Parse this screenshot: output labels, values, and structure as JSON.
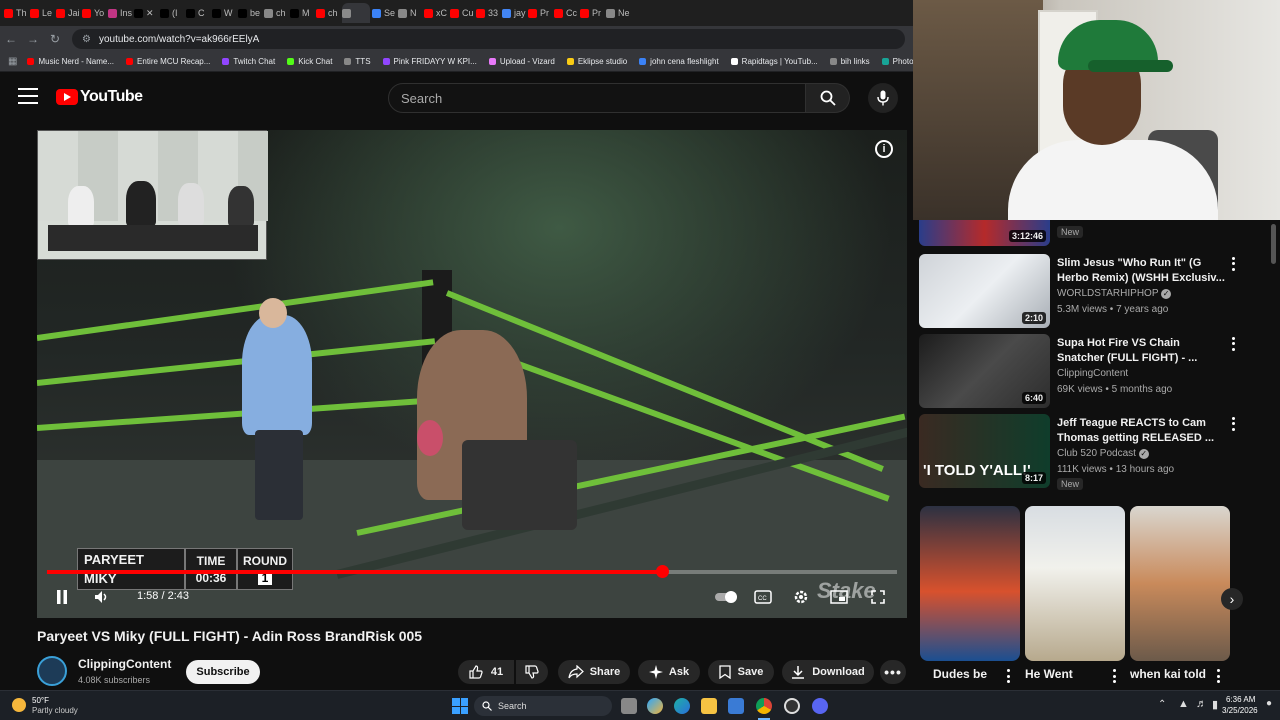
{
  "browser": {
    "tabs": [
      {
        "label": "Th",
        "color": "#ff0000"
      },
      {
        "label": "Le",
        "color": "#ff0000"
      },
      {
        "label": "Jai",
        "color": "#ff0000"
      },
      {
        "label": "Yo",
        "color": "#ff0000"
      },
      {
        "label": "Ins",
        "color": "#c13584"
      },
      {
        "label": "✕",
        "color": "#000000"
      },
      {
        "label": "(I",
        "color": "#000000"
      },
      {
        "label": "C",
        "color": "#000000"
      },
      {
        "label": "W",
        "color": "#000000"
      },
      {
        "label": "be",
        "color": "#000000"
      },
      {
        "label": "ch",
        "color": "#888888"
      },
      {
        "label": "M",
        "color": "#000000"
      },
      {
        "label": "ch",
        "color": "#ff0000"
      },
      {
        "label": "",
        "color": "#8a8a8a"
      },
      {
        "label": "Se",
        "color": "#3b82f6"
      },
      {
        "label": "N",
        "color": "#888888"
      },
      {
        "label": "xC",
        "color": "#ff0000"
      },
      {
        "label": "Cu",
        "color": "#ff0000"
      },
      {
        "label": "33",
        "color": "#ff0000"
      },
      {
        "label": "jay",
        "color": "#4285f4"
      },
      {
        "label": "Pr",
        "color": "#ff0000"
      },
      {
        "label": "Cc",
        "color": "#ff0000"
      },
      {
        "label": "Pr",
        "color": "#ff0000"
      },
      {
        "label": "Ne",
        "color": "#888888"
      }
    ],
    "url": "youtube.com/watch?v=ak966rEElyA",
    "bookmarks": [
      {
        "label": "Music Nerd - Name...",
        "color": "#ff0000"
      },
      {
        "label": "Entire MCU Recap...",
        "color": "#ff0000"
      },
      {
        "label": "Twitch Chat",
        "color": "#9146ff"
      },
      {
        "label": "Kick Chat",
        "color": "#53fc18"
      },
      {
        "label": "TTS",
        "color": "#888888"
      },
      {
        "label": "Pink FRIDAYY W KPI...",
        "color": "#9146ff"
      },
      {
        "label": "Upload - Vizard",
        "color": "#e879f9"
      },
      {
        "label": "Eklipse studio",
        "color": "#facc15"
      },
      {
        "label": "john cena fleshlight",
        "color": "#3b82f6"
      },
      {
        "label": "Rapidtags | YouTub...",
        "color": "#ffffff"
      },
      {
        "label": "bih links",
        "color": "#888888"
      },
      {
        "label": "Photopea",
        "color": "#18a497"
      }
    ]
  },
  "youtube": {
    "logo_text": "YouTube",
    "search_placeholder": "Search"
  },
  "player": {
    "progress": 0.724,
    "time_current": "1:58",
    "time_total": "2:43",
    "time_display": "1:58 / 2:43",
    "scorebug": {
      "fighter1": "PARYEET",
      "fighter2": "MIKY",
      "time_label": "TIME",
      "time_value": "00:36",
      "round_label": "ROUND",
      "round_value": "1"
    }
  },
  "video": {
    "title": "Paryeet VS Miky (FULL FIGHT) - Adin Ross BrandRisk 005",
    "channel_name": "ClippingContent",
    "subscribers": "4.08K subscribers",
    "subscribe_label": "Subscribe",
    "likes": "41",
    "share_label": "Share",
    "ask_label": "Ask",
    "save_label": "Save",
    "download_label": "Download"
  },
  "sidebar": {
    "top_partial": {
      "duration": "3:12:46",
      "badge": "New"
    },
    "recommendations": [
      {
        "title": "Slim Jesus \"Who Run It\" (G Herbo Remix) (WSHH Exclusiv...",
        "channel": "WORLDSTARHIPHOP",
        "meta": "5.3M views • 7 years ago",
        "duration": "2:10",
        "badge": ""
      },
      {
        "title": "Supa Hot Fire VS Chain Snatcher (FULL FIGHT) - ...",
        "channel": "ClippingContent",
        "meta": "69K views • 5 months ago",
        "duration": "6:40",
        "badge": ""
      },
      {
        "title": "Jeff Teague REACTS to Cam Thomas getting RELEASED ...",
        "channel": "Club 520 Podcast",
        "meta": "111K views • 13 hours ago",
        "duration": "8:17",
        "badge": "New"
      }
    ],
    "thumb_overlay_text": "'I TOLD Y'ALL!'",
    "shorts": [
      {
        "title": "Dudes be"
      },
      {
        "title": "He Went"
      },
      {
        "title": "when kai told"
      }
    ]
  },
  "taskbar": {
    "weather_temp": "50°F",
    "weather_desc": "Partly cloudy",
    "search_label": "Search",
    "time": "6:36 AM",
    "date": "3/25/2026"
  }
}
